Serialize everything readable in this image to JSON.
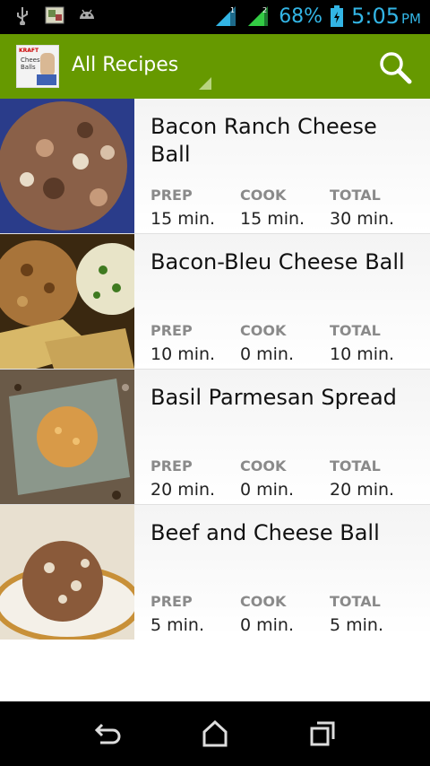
{
  "status_bar": {
    "battery_percent": "68%",
    "time": "5:05",
    "ampm": "PM",
    "icons": [
      "usb-icon",
      "photo-icon",
      "android-icon",
      "signal-icon-1",
      "signal-icon-2",
      "battery-icon"
    ],
    "accent": "#33b5e5"
  },
  "action_bar": {
    "title": "All Recipes",
    "app_icon_text_1": "KRAFT",
    "app_icon_text_2": "Cheese Balls",
    "color": "#669900"
  },
  "labels": {
    "prep": "PREP",
    "cook": "COOK",
    "total": "TOTAL"
  },
  "recipes": [
    {
      "title": "Bacon Ranch Cheese Ball",
      "prep": "15 min.",
      "cook": "15 min.",
      "total": "30 min."
    },
    {
      "title": "Bacon-Bleu Cheese Ball",
      "prep": "10 min.",
      "cook": "0 min.",
      "total": "10 min."
    },
    {
      "title": "Basil Parmesan Spread",
      "prep": "20 min.",
      "cook": "0 min.",
      "total": "20 min."
    },
    {
      "title": "Beef and Cheese Ball",
      "prep": "5 min.",
      "cook": "0 min.",
      "total": "5 min."
    }
  ],
  "nav": [
    "back-icon",
    "home-icon",
    "recent-apps-icon"
  ]
}
